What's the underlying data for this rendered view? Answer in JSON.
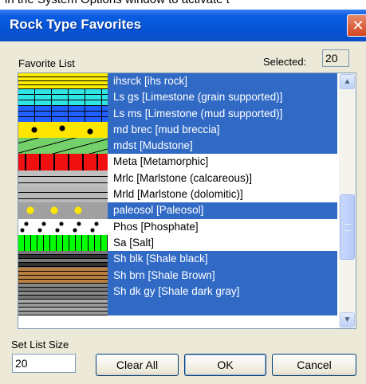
{
  "background_text": "in the System Options window to activate t",
  "dialog": {
    "title": "Rock Type Favorites",
    "close_icon": "close-icon"
  },
  "favorite_list_label": "Favorite List",
  "selected_label": "Selected:",
  "selected_count": "20",
  "list": {
    "items": [
      {
        "label": "ihsrck [ihs rock]",
        "selected": true,
        "pattern": "ihs-rock"
      },
      {
        "label": "Ls gs [Limestone (grain supported)]",
        "selected": true,
        "pattern": "limestone-grain"
      },
      {
        "label": "Ls ms [Limestone (mud supported)]",
        "selected": true,
        "pattern": "limestone-mud"
      },
      {
        "label": "md brec [mud breccia]",
        "selected": true,
        "pattern": "mud-breccia"
      },
      {
        "label": "mdst [Mudstone]",
        "selected": true,
        "pattern": "mudstone"
      },
      {
        "label": "Meta [Metamorphic]",
        "selected": false,
        "pattern": "metamorphic"
      },
      {
        "label": "Mrlc [Marlstone (calcareous)]",
        "selected": false,
        "pattern": "marlstone-calc"
      },
      {
        "label": "Mrld [Marlstone (dolomitic)]",
        "selected": false,
        "pattern": "marlstone-dolo"
      },
      {
        "label": "paleosol [Paleosol]",
        "selected": true,
        "pattern": "paleosol"
      },
      {
        "label": "Phos [Phosphate]",
        "selected": false,
        "pattern": "phosphate"
      },
      {
        "label": "Sa [Salt]",
        "selected": false,
        "pattern": "salt"
      },
      {
        "label": "Sh blk [Shale black]",
        "selected": true,
        "pattern": "shale-black"
      },
      {
        "label": "Sh brn [Shale Brown]",
        "selected": true,
        "pattern": "shale-brown"
      },
      {
        "label": "Sh dk gy [Shale dark gray]",
        "selected": true,
        "pattern": "shale-dark-gray"
      },
      {
        "label": "",
        "selected": true,
        "pattern": "shale-gray"
      }
    ]
  },
  "scrollbar": {
    "up_icon": "chevron-up-icon",
    "down_icon": "chevron-down-icon"
  },
  "set_list_size_label": "Set List Size",
  "list_size_value": "20",
  "buttons": {
    "clear_all": "Clear All",
    "ok": "OK",
    "cancel": "Cancel"
  },
  "colors": {
    "title_bar": "#0655d6",
    "selection": "#316ac5",
    "dialog_bg": "#ece9d8"
  }
}
